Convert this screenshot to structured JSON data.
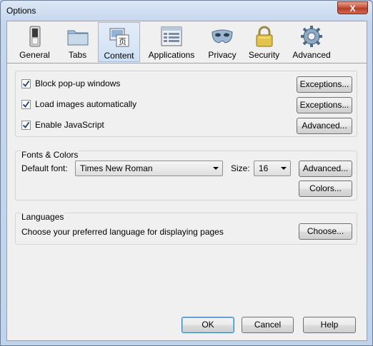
{
  "window": {
    "title": "Options",
    "close_label": "X"
  },
  "toolbar": {
    "tabs": [
      {
        "label": "General",
        "icon": "switch-icon"
      },
      {
        "label": "Tabs",
        "icon": "folder-tabs-icon"
      },
      {
        "label": "Content",
        "icon": "content-page-icon"
      },
      {
        "label": "Applications",
        "icon": "applications-icon"
      },
      {
        "label": "Privacy",
        "icon": "mask-icon"
      },
      {
        "label": "Security",
        "icon": "padlock-icon"
      },
      {
        "label": "Advanced",
        "icon": "gear-icon"
      }
    ],
    "selected": "Content"
  },
  "content": {
    "block_popups": {
      "label": "Block pop-up windows",
      "checked": true,
      "button": "Exceptions..."
    },
    "load_images": {
      "label": "Load images automatically",
      "checked": true,
      "button": "Exceptions..."
    },
    "javascript": {
      "label": "Enable JavaScript",
      "checked": true,
      "button": "Advanced..."
    }
  },
  "fonts": {
    "legend": "Fonts & Colors",
    "default_font_label": "Default font:",
    "default_font_value": "Times New Roman",
    "size_label": "Size:",
    "size_value": "16",
    "advanced_button": "Advanced...",
    "colors_button": "Colors..."
  },
  "languages": {
    "legend": "Languages",
    "description": "Choose your preferred language for displaying pages",
    "choose_button": "Choose..."
  },
  "footer": {
    "ok": "OK",
    "cancel": "Cancel",
    "help": "Help"
  },
  "colors": {
    "selected_tab": "#cfe0f4",
    "dialog_bg": "#f0f0f0",
    "close_red": "#c8553e"
  }
}
